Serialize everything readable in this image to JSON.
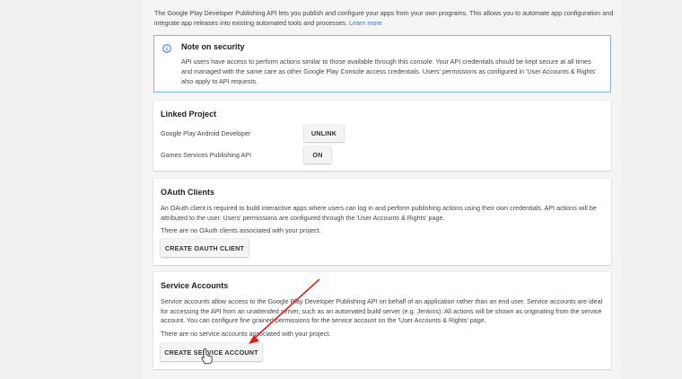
{
  "intro": {
    "text": "The Google Play Developer Publishing API lets you publish and configure your apps from your own programs. This allows you to automate app configuration and integrate app releases into existing automated tools and processes.",
    "learn_more": "Learn more"
  },
  "note": {
    "icon": "info-icon",
    "title": "Note on security",
    "body": "API users have access to perform actions similar to those available through this console. Your API credentials should be kept secure at all times and managed with the same care as other Google Play Console access credentials. Users' permissions as configured in 'User Accounts & Rights' also apply to API requests."
  },
  "linked_project": {
    "title": "Linked Project",
    "rows": [
      {
        "label": "Google Play Android Developer",
        "button": "UNLINK"
      },
      {
        "label": "Games Services Publishing API",
        "button": "ON"
      }
    ]
  },
  "oauth": {
    "title": "OAuth Clients",
    "description": "An OAuth client is required to build interactive apps where users can log in and perform publishing actions using their own credentials. API actions will be attributed to the user. Users' permissions are configured through the 'User Accounts & Rights' page.",
    "empty": "There are no OAuth clients associated with your project.",
    "button": "CREATE OAUTH CLIENT"
  },
  "service_accounts": {
    "title": "Service Accounts",
    "description": "Service accounts allow access to the Google Play Developer Publishing API on behalf of an application rather than an end user. Service accounts are ideal for accessing the API from an unattended server, such as an automated build server (e.g. Jenkins). All actions will be shown as originating from the service account. You can configure fine grained permissions for the service account on the 'User Accounts & Rights' page.",
    "empty": "There are no service accounts associated with your project.",
    "button": "CREATE SERVICE ACCOUNT"
  },
  "colors": {
    "link": "#3a73c8",
    "info_border": "#8ab3e6",
    "arrow": "#e02020"
  }
}
